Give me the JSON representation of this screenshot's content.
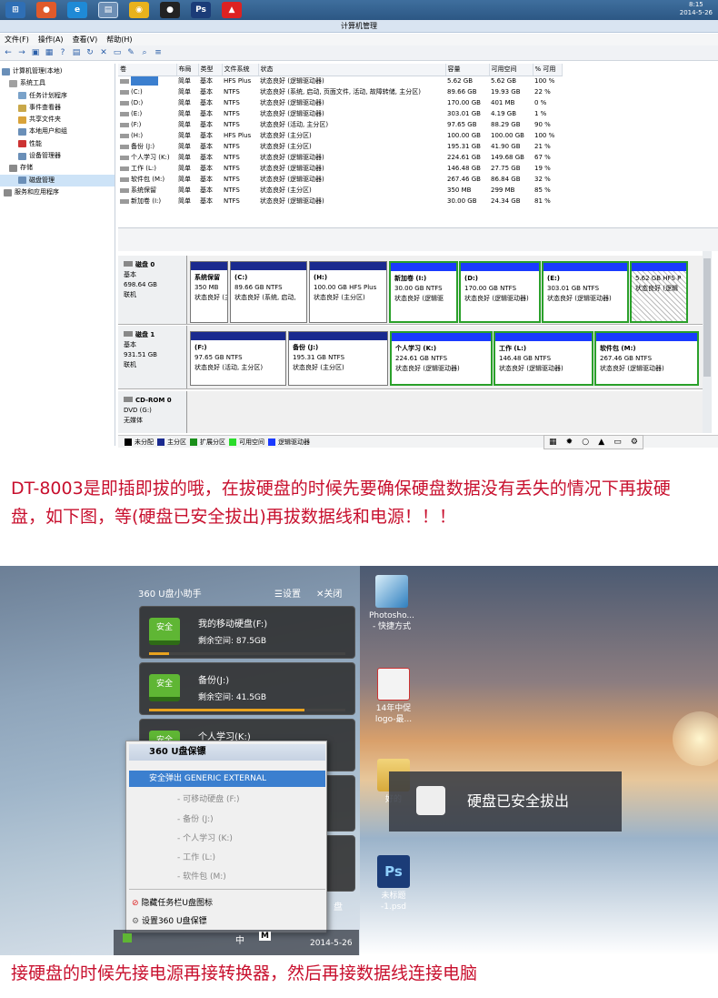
{
  "taskbar": {
    "time": "8:15",
    "date": "2014-5-26",
    "ps_label": "Ps"
  },
  "window": {
    "title": "计算机管理",
    "menu": [
      "文件(F)",
      "操作(A)",
      "查看(V)",
      "帮助(H)"
    ]
  },
  "tree": [
    "计算机管理(本地)",
    "系统工具",
    "任务计划程序",
    "事件查看器",
    "共享文件夹",
    "本地用户和组",
    "性能",
    "设备管理器",
    "存储",
    "磁盘管理",
    "服务和应用程序"
  ],
  "volume_table": {
    "headers": [
      "卷",
      "布局",
      "类型",
      "文件系统",
      "状态",
      "容量",
      "可用空间",
      "% 可用"
    ],
    "rows": [
      [
        "",
        "简单",
        "基本",
        "HFS Plus",
        "状态良好 (逻辑驱动器)",
        "5.62 GB",
        "5.62 GB",
        "100 %"
      ],
      [
        "(C:)",
        "简单",
        "基本",
        "NTFS",
        "状态良好 (系统, 启动, 页面文件, 活动, 故障转储, 主分区)",
        "89.66 GB",
        "19.93 GB",
        "22 %"
      ],
      [
        "(D:)",
        "简单",
        "基本",
        "NTFS",
        "状态良好 (逻辑驱动器)",
        "170.00 GB",
        "401 MB",
        "0 %"
      ],
      [
        "(E:)",
        "简单",
        "基本",
        "NTFS",
        "状态良好 (逻辑驱动器)",
        "303.01 GB",
        "4.19 GB",
        "1 %"
      ],
      [
        "(F:)",
        "简单",
        "基本",
        "NTFS",
        "状态良好 (活动, 主分区)",
        "97.65 GB",
        "88.29 GB",
        "90 %"
      ],
      [
        "(H:)",
        "简单",
        "基本",
        "HFS Plus",
        "状态良好 (主分区)",
        "100.00 GB",
        "100.00 GB",
        "100 %"
      ],
      [
        "备份 (J:)",
        "简单",
        "基本",
        "NTFS",
        "状态良好 (主分区)",
        "195.31 GB",
        "41.90 GB",
        "21 %"
      ],
      [
        "个人学习 (K:)",
        "简单",
        "基本",
        "NTFS",
        "状态良好 (逻辑驱动器)",
        "224.61 GB",
        "149.68 GB",
        "67 %"
      ],
      [
        "工作 (L:)",
        "简单",
        "基本",
        "NTFS",
        "状态良好 (逻辑驱动器)",
        "146.48 GB",
        "27.75 GB",
        "19 %"
      ],
      [
        "软件包 (M:)",
        "简单",
        "基本",
        "NTFS",
        "状态良好 (逻辑驱动器)",
        "267.46 GB",
        "86.84 GB",
        "32 %"
      ],
      [
        "系统保留",
        "简单",
        "基本",
        "NTFS",
        "状态良好 (主分区)",
        "350 MB",
        "299 MB",
        "85 %"
      ],
      [
        "新加卷 (I:)",
        "简单",
        "基本",
        "NTFS",
        "状态良好 (逻辑驱动器)",
        "30.00 GB",
        "24.34 GB",
        "81 %"
      ]
    ]
  },
  "disks": {
    "disk0": {
      "label": [
        "磁盘 0",
        "基本",
        "698.64 GB",
        "联机"
      ],
      "parts": [
        [
          "系统保留",
          "350 MB",
          "状态良好 (主分区)"
        ],
        [
          "(C:)",
          "89.66 GB NTFS",
          "状态良好 (系统, 启动,"
        ],
        [
          "(H:)",
          "100.00 GB HFS Plus",
          "状态良好 (主分区)"
        ],
        [
          "新加卷 (I:)",
          "30.00 GB NTFS",
          "状态良好 (逻辑驱"
        ],
        [
          "(D:)",
          "170.00 GB NTFS",
          "状态良好 (逻辑驱动器)"
        ],
        [
          "(E:)",
          "303.01 GB NTFS",
          "状态良好 (逻辑驱动器)"
        ],
        [
          "",
          "5.62 GB HFS P",
          "状态良好 (逻辑"
        ]
      ]
    },
    "disk1": {
      "label": [
        "磁盘 1",
        "基本",
        "931.51 GB",
        "联机"
      ],
      "parts": [
        [
          "(F:)",
          "97.65 GB NTFS",
          "状态良好 (活动, 主分区)"
        ],
        [
          "备份 (J:)",
          "195.31 GB NTFS",
          "状态良好 (主分区)"
        ],
        [
          "个人学习 (K:)",
          "224.61 GB NTFS",
          "状态良好 (逻辑驱动器)"
        ],
        [
          "工作 (L:)",
          "146.48 GB NTFS",
          "状态良好 (逻辑驱动器)"
        ],
        [
          "软件包 (M:)",
          "267.46 GB NTFS",
          "状态良好 (逻辑驱动器)"
        ]
      ]
    },
    "cdrom": {
      "label": [
        "CD-ROM 0",
        "DVD (G:)",
        "",
        "无媒体"
      ]
    }
  },
  "legend": [
    "未分配",
    "主分区",
    "扩展分区",
    "可用空间",
    "逻辑驱动器"
  ],
  "note1": "DT-8003是即插即拔的哦，在拔硬盘的时候先要确保硬盘数据没有丢失的情况下再拔硬盘，如下图，等(硬盘已安全拔出)再拔数据线和电源！！！",
  "p360": {
    "title": "360 U盘小助手",
    "settings": "设置",
    "close": "关闭",
    "safe": "安全",
    "cards": [
      {
        "name": "我的移动硬盘(F:)",
        "space": "剩余空间: 87.5GB",
        "used": 0.1
      },
      {
        "name": "备份(J:)",
        "space": "剩余空间: 41.5GB",
        "used": 0.79
      },
      {
        "name": "个人学习(K:)",
        "space": "",
        "used": 0
      }
    ],
    "menu_title": "360 U盘保镖",
    "eject": "安全弹出 GENERIC EXTERNAL",
    "subs": [
      "- 可移动硬盘 (F:)",
      "- 备份 (J:)",
      "- 个人学习 (K:)",
      "- 工作 (L:)",
      "- 软件包 (M:)"
    ],
    "hide": "隐藏任务栏U盘图标",
    "setting": "设置360 U盘保镖",
    "tb_date": "2014-5-26",
    "tb_pan": "盘",
    "tb_zh": "中"
  },
  "desktop": {
    "icons": [
      "Photosho...\n- 快捷方式",
      "14年中促\nlogo-最...",
      "好的",
      "未标题\n-1.psd"
    ],
    "psd_label": "PSD",
    "ps_label": "Ps",
    "toast": "硬盘已安全拔出"
  },
  "note2": "接硬盘的时候先接电源再接转换器，然后再接数据线连接电脑"
}
